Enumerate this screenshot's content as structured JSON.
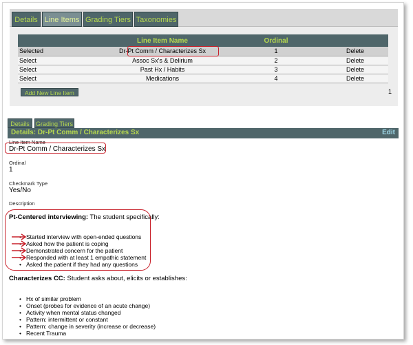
{
  "top_tabs": [
    {
      "label": "Details"
    },
    {
      "label": "Line Items",
      "active": true
    },
    {
      "label": "Grading Tiers"
    },
    {
      "label": "Taxonomies"
    }
  ],
  "line_items": {
    "headers": {
      "name": "Line Item Name",
      "ordinal": "Ordinal"
    },
    "rows": [
      {
        "select": "Selected",
        "name": "Dr-Pt Comm / Characterizes Sx",
        "ordinal": "1",
        "delete": "Delete"
      },
      {
        "select": "Select",
        "name": "Assoc Sx's & Delirium",
        "ordinal": "2",
        "delete": "Delete"
      },
      {
        "select": "Select",
        "name": "Past Hx / Habits",
        "ordinal": "3",
        "delete": "Delete"
      },
      {
        "select": "Select",
        "name": "Medications",
        "ordinal": "4",
        "delete": "Delete"
      }
    ],
    "add_button": "Add New Line Item",
    "page_number": "1"
  },
  "detail_tabs": [
    {
      "label": "Details"
    },
    {
      "label": "Grading Tiers"
    }
  ],
  "details": {
    "header": "Details: Dr-Pt Comm / Characterizes Sx",
    "edit": "Edit",
    "fields": {
      "name_label": "Line Item Name",
      "name_value": "Dr-Pt Comm / Characterizes Sx",
      "ordinal_label": "Ordinal",
      "ordinal_value": "1",
      "checkmark_label": "Checkmark Type",
      "checkmark_value": "Yes/No",
      "description_label": "Description"
    },
    "sections": [
      {
        "heading_bold": "Pt-Centered interviewing:",
        "heading_rest": " The student specifically:",
        "items": [
          "Started interview with open-ended questions",
          "Asked how the patient is coping",
          "Demonstrated concern for the patient",
          "Responded with at least 1 empathic statement",
          "Asked the patient if they had any questions"
        ]
      },
      {
        "heading_bold": "Characterizes CC:",
        "heading_rest": " Student asks about, elicits or establishes:",
        "items": [
          "Hx of similar problem",
          "Onset (probes for evidence of an acute change)",
          "Activity when mental status changed",
          "Pattern: intermittent or constant",
          "Pattern: change in severity (increase or decrease)",
          "Recent Trauma"
        ]
      }
    ]
  },
  "colors": {
    "header_bg": "#4f666a",
    "header_text": "#b6d84f",
    "highlight": "#c8202a",
    "edit_link": "#9fd8e8"
  }
}
